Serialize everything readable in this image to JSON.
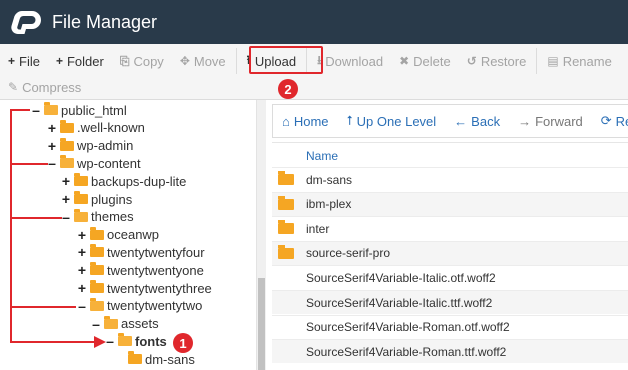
{
  "header": {
    "title": "File Manager"
  },
  "toolbar": {
    "row1": [
      {
        "label": "File",
        "icon": "+",
        "enabled": true
      },
      {
        "label": "Folder",
        "icon": "+",
        "enabled": true
      },
      {
        "label": "Copy",
        "icon": "⎘",
        "enabled": false
      },
      {
        "label": "Move",
        "icon": "✥",
        "enabled": false
      },
      {
        "label": "Upload",
        "icon": "⭱",
        "enabled": true
      },
      {
        "label": "Download",
        "icon": "⭳",
        "enabled": false
      },
      {
        "label": "Delete",
        "icon": "✖",
        "enabled": false
      },
      {
        "label": "Restore",
        "icon": "↺",
        "enabled": false
      },
      {
        "label": "Rename",
        "icon": "▤",
        "enabled": false
      }
    ],
    "row2": [
      {
        "label": "Compress",
        "icon": "✎",
        "enabled": false
      }
    ]
  },
  "annotations": {
    "badge1": "1",
    "badge2": "2"
  },
  "tree": [
    {
      "label": "public_html",
      "toggle": "–",
      "depth": 0
    },
    {
      "label": ".well-known",
      "toggle": "+",
      "depth": 1
    },
    {
      "label": "wp-admin",
      "toggle": "+",
      "depth": 1
    },
    {
      "label": "wp-content",
      "toggle": "–",
      "depth": 1
    },
    {
      "label": "backups-dup-lite",
      "toggle": "+",
      "depth": 2
    },
    {
      "label": "plugins",
      "toggle": "+",
      "depth": 2
    },
    {
      "label": "themes",
      "toggle": "–",
      "depth": 2
    },
    {
      "label": "oceanwp",
      "toggle": "+",
      "depth": 3
    },
    {
      "label": "twentytwentyfour",
      "toggle": "+",
      "depth": 3
    },
    {
      "label": "twentytwentyone",
      "toggle": "+",
      "depth": 3
    },
    {
      "label": "twentytwentythree",
      "toggle": "+",
      "depth": 3
    },
    {
      "label": "twentytwentytwo",
      "toggle": "–",
      "depth": 3
    },
    {
      "label": "assets",
      "toggle": "–",
      "depth": 4
    },
    {
      "label": "fonts",
      "toggle": "–",
      "depth": 5,
      "bold": true
    },
    {
      "label": "dm-sans",
      "toggle": "",
      "depth": 6
    }
  ],
  "navbar": [
    {
      "label": "Home",
      "icon": "⌂",
      "dim": false
    },
    {
      "label": "Up One Level",
      "icon": "⭡",
      "dim": false
    },
    {
      "label": "Back",
      "icon": "←",
      "dim": false
    },
    {
      "label": "Forward",
      "icon": "→",
      "dim": true
    },
    {
      "label": "Reload",
      "icon": "⟳",
      "dim": false
    }
  ],
  "files": {
    "column_name": "Name",
    "rows": [
      {
        "name": "dm-sans",
        "folder": true
      },
      {
        "name": "ibm-plex",
        "folder": true
      },
      {
        "name": "inter",
        "folder": true
      },
      {
        "name": "source-serif-pro",
        "folder": true
      },
      {
        "name": "SourceSerif4Variable-Italic.otf.woff2",
        "folder": false
      },
      {
        "name": "SourceSerif4Variable-Italic.ttf.woff2",
        "folder": false
      },
      {
        "name": "SourceSerif4Variable-Roman.otf.woff2",
        "folder": false
      },
      {
        "name": "SourceSerif4Variable-Roman.ttf.woff2",
        "folder": false
      }
    ]
  },
  "colors": {
    "header_bg": "#293a4a",
    "accent": "#e0272c",
    "link": "#2b6fb6",
    "folder": "#f5a623"
  }
}
